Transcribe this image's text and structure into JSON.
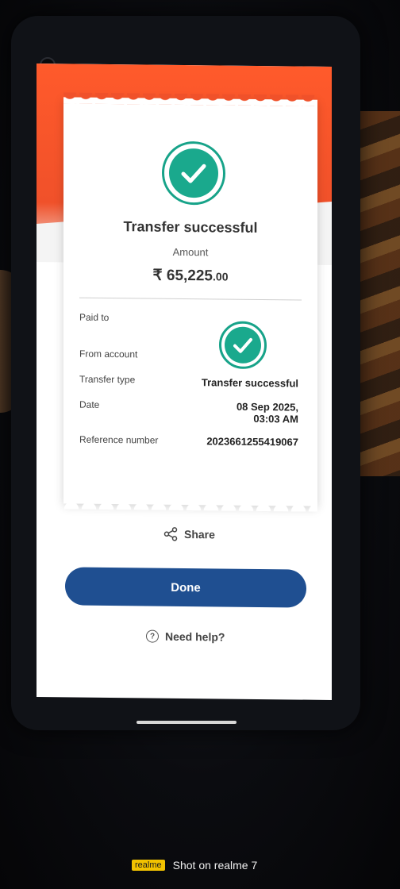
{
  "receipt": {
    "title": "Transfer successful",
    "amount_label": "Amount",
    "currency_symbol": "₹",
    "amount_main": "65,225",
    "amount_decimal": ".00",
    "rows": [
      {
        "label": "Paid to",
        "value": ""
      },
      {
        "label": "From account",
        "value": ""
      },
      {
        "label": "Transfer type",
        "value": "Transfer successful"
      },
      {
        "label": "Date",
        "value_line1": "08 Sep 2025,",
        "value_line2": "03:03 AM"
      },
      {
        "label": "Reference number",
        "value": "2023661255419067"
      }
    ]
  },
  "actions": {
    "share_label": "Share",
    "done_label": "Done",
    "help_label": "Need help?"
  },
  "watermark": {
    "brand": "realme",
    "text": "Shot on realme 7"
  },
  "colors": {
    "header_orange": "#f0512a",
    "success_green": "#1aa98d",
    "button_blue": "#1f4f91"
  }
}
